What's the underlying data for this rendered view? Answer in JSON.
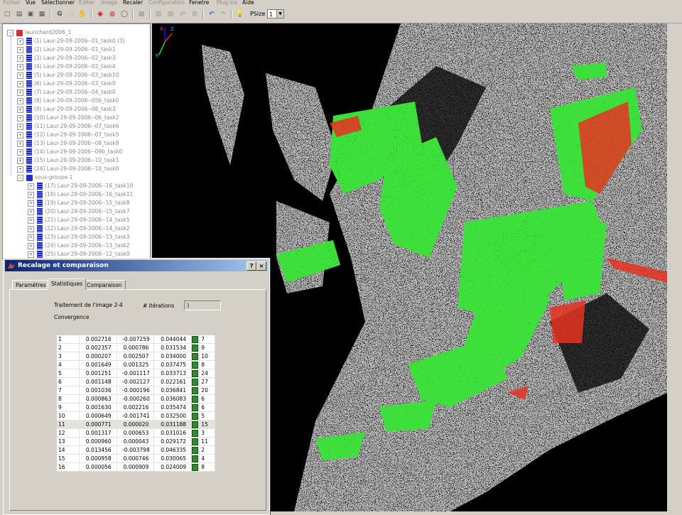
{
  "menu": {
    "items": [
      {
        "label": "Fichier",
        "enabled": false
      },
      {
        "label": "Vue",
        "enabled": true
      },
      {
        "label": "Sélectionner",
        "enabled": true
      },
      {
        "label": "Editer",
        "enabled": false
      },
      {
        "label": "Image",
        "enabled": false
      },
      {
        "label": "Recaler",
        "enabled": true
      },
      {
        "label": "Configuration",
        "enabled": false
      },
      {
        "label": "Fenetre",
        "enabled": true
      },
      {
        "label": "Plug-ins",
        "enabled": false
      },
      {
        "label": "Aide",
        "enabled": true
      }
    ]
  },
  "toolbar": {
    "icons": [
      "new-icon",
      "open-icon",
      "save-icon",
      "properties-icon",
      "g-icon",
      "lasso-icon",
      "hand-icon",
      "eye-red-icon",
      "eye-red-mesh-icon",
      "eye-outline-icon",
      "layer-icon",
      "grid-a-icon",
      "grid-b-icon",
      "graph-icon",
      "tree-icon",
      "undo-icon",
      "redo-icon",
      "bulb-icon"
    ],
    "psize_label": "PSize",
    "psize_value": "1"
  },
  "tree": {
    "root": "laurichard2006_1",
    "items": [
      "(1) Laur-29-09-2006--01_task0 (3)",
      "(2) Laur-29-09-2006--01_task1",
      "(3) Laur-29-09-2006--02_task3",
      "(4) Laur-29-09-2006--02_task4",
      "(5) Laur-29-09-2006--03_task10",
      "(6) Laur-29-09-2006--03_task9",
      "(7) Laur-29-09-2006--04_task0",
      "(8) Laur-29-09-2006--05b_task0",
      "(9) Laur-29-09-2006--06_task3",
      "(10) Laur-29-09-2006--06_task2",
      "(11) Laur-29-09-2006--07_task6",
      "(12) Laur-29-09-2006--07_task5",
      "(13) Laur-29-09-2006--08_task8",
      "(14) Laur-29-09-2006--09b_task0",
      "(15) Laur-29-09-2006--10_task1",
      "(16) Laur-29-09-2006--10_task0"
    ],
    "group": "sous-groupe 1",
    "group_items": [
      "(17) Laur-29-09-2006--16_task10",
      "(18) Laur-29-09-2006--16_task11",
      "(19) Laur-29-09-2006--15_task8",
      "(20) Laur-29-09-2006--15_task7",
      "(21) Laur-29-09-2006--14_task5",
      "(22) Laur-29-09-2006--14_task2",
      "(23) Laur-29-09-2006--13_task3",
      "(24) Laur-29-09-2006--13_task2",
      "(25) Laur-29-09-2006--12_task0"
    ]
  },
  "viewport": {
    "axis_x": "X",
    "axis_y": "Y",
    "axis_z": "Z",
    "colors": {
      "green": "#3ee03a",
      "red": "#e83020",
      "gray": "#b8b8b8"
    }
  },
  "dialog": {
    "title": "Recalage et comparaison",
    "help_label": "?",
    "close_label": "×",
    "tabs": [
      "Paramètres",
      "Statistiques",
      "Comparaison"
    ],
    "active_tab": 1,
    "processing_label": "Traitement de l'image 2-4",
    "iterations_label": "# itérations",
    "iterations_value": "3",
    "convergence_label": "Convergence",
    "rows": [
      [
        "1",
        "0.002716",
        "-0.007259",
        "0.044044",
        "7"
      ],
      [
        "2",
        "0.002357",
        "0.000786",
        "0.031534",
        "9"
      ],
      [
        "3",
        "0.000207",
        "0.002507",
        "0.034000",
        "10"
      ],
      [
        "4",
        "0.001649",
        "0.001325",
        "0.037475",
        "8"
      ],
      [
        "5",
        "0.001251",
        "-0.001117",
        "0.033713",
        "24"
      ],
      [
        "6",
        "0.001148",
        "-0.002127",
        "0.022161",
        "27"
      ],
      [
        "7",
        "0.001036",
        "-0.000196",
        "0.036841",
        "20"
      ],
      [
        "8",
        "0.000863",
        "-0.000260",
        "0.036083",
        "6"
      ],
      [
        "9",
        "0.001630",
        "0.002216",
        "0.035474",
        "6"
      ],
      [
        "10",
        "0.000649",
        "-0.001741",
        "0.032500",
        "5"
      ],
      [
        "11",
        "0.000771",
        "0.000020",
        "0.031188",
        "15"
      ],
      [
        "12",
        "0.001317",
        "0.000653",
        "0.031016",
        "3"
      ],
      [
        "13",
        "0.000960",
        "0.000043",
        "0.029172",
        "11"
      ],
      [
        "14",
        "0.013456",
        "-0.003798",
        "0.046335",
        "2"
      ],
      [
        "15",
        "0.000958",
        "0.000746",
        "0.030065",
        "4"
      ],
      [
        "16",
        "0.000056",
        "0.000909",
        "0.024009",
        "8"
      ]
    ],
    "selected_row": 10
  }
}
